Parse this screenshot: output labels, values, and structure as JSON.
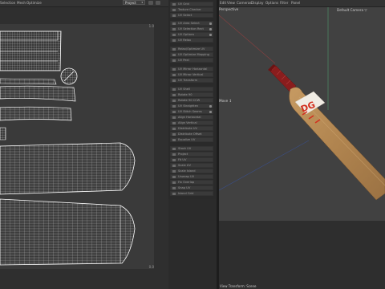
{
  "uv_editor": {
    "menu": [
      "Selection",
      "Mesh",
      "Optimize"
    ],
    "project_select": "Project",
    "corner_top": "1.0",
    "corner_bottom": "0.0"
  },
  "tool_panel": {
    "items": [
      "UV Grid",
      "Texture Checker",
      "UV Select",
      "UV Area Select",
      "UV Selection Rect",
      "UV Options",
      "UV Relax",
      "Relax/Optimize UV",
      "UV Optimize Mapping",
      "UV Peel",
      "UV Mirror Horizontal",
      "UV Mirror Vertical",
      "UV Transform",
      "UV Shell",
      "Rotate 90",
      "Rotate 90 CCW",
      "UV Straighten",
      "UV Stitch Seams",
      "Align Horizontal",
      "Align Vertical",
      "Distribute UV",
      "Distribute Offset",
      "Equalize UV",
      "Stack UV",
      "Project",
      "Fit UV",
      "Scale UV",
      "Scale Island",
      "Unwrap UV",
      "Fix Overlap",
      "Snap UV",
      "Island Grid",
      "Pack UV"
    ]
  },
  "viewport": {
    "menu": [
      "Edit",
      "View",
      "Cameras",
      "Display",
      "Options",
      "Filter",
      "Panel"
    ],
    "label_top_left": "Perspective",
    "label_top_right": "Default Camera ▽",
    "label_mid": "Move ↕",
    "label_bottom": "View Transform: Scene",
    "brand_text": "DG"
  },
  "colors": {
    "bg": "#2b2b2b",
    "uv_lines": "#ffffff",
    "bat_wood": "#b58a55",
    "bat_handle": "#8a1d1d",
    "brand_red": "#d23020"
  }
}
